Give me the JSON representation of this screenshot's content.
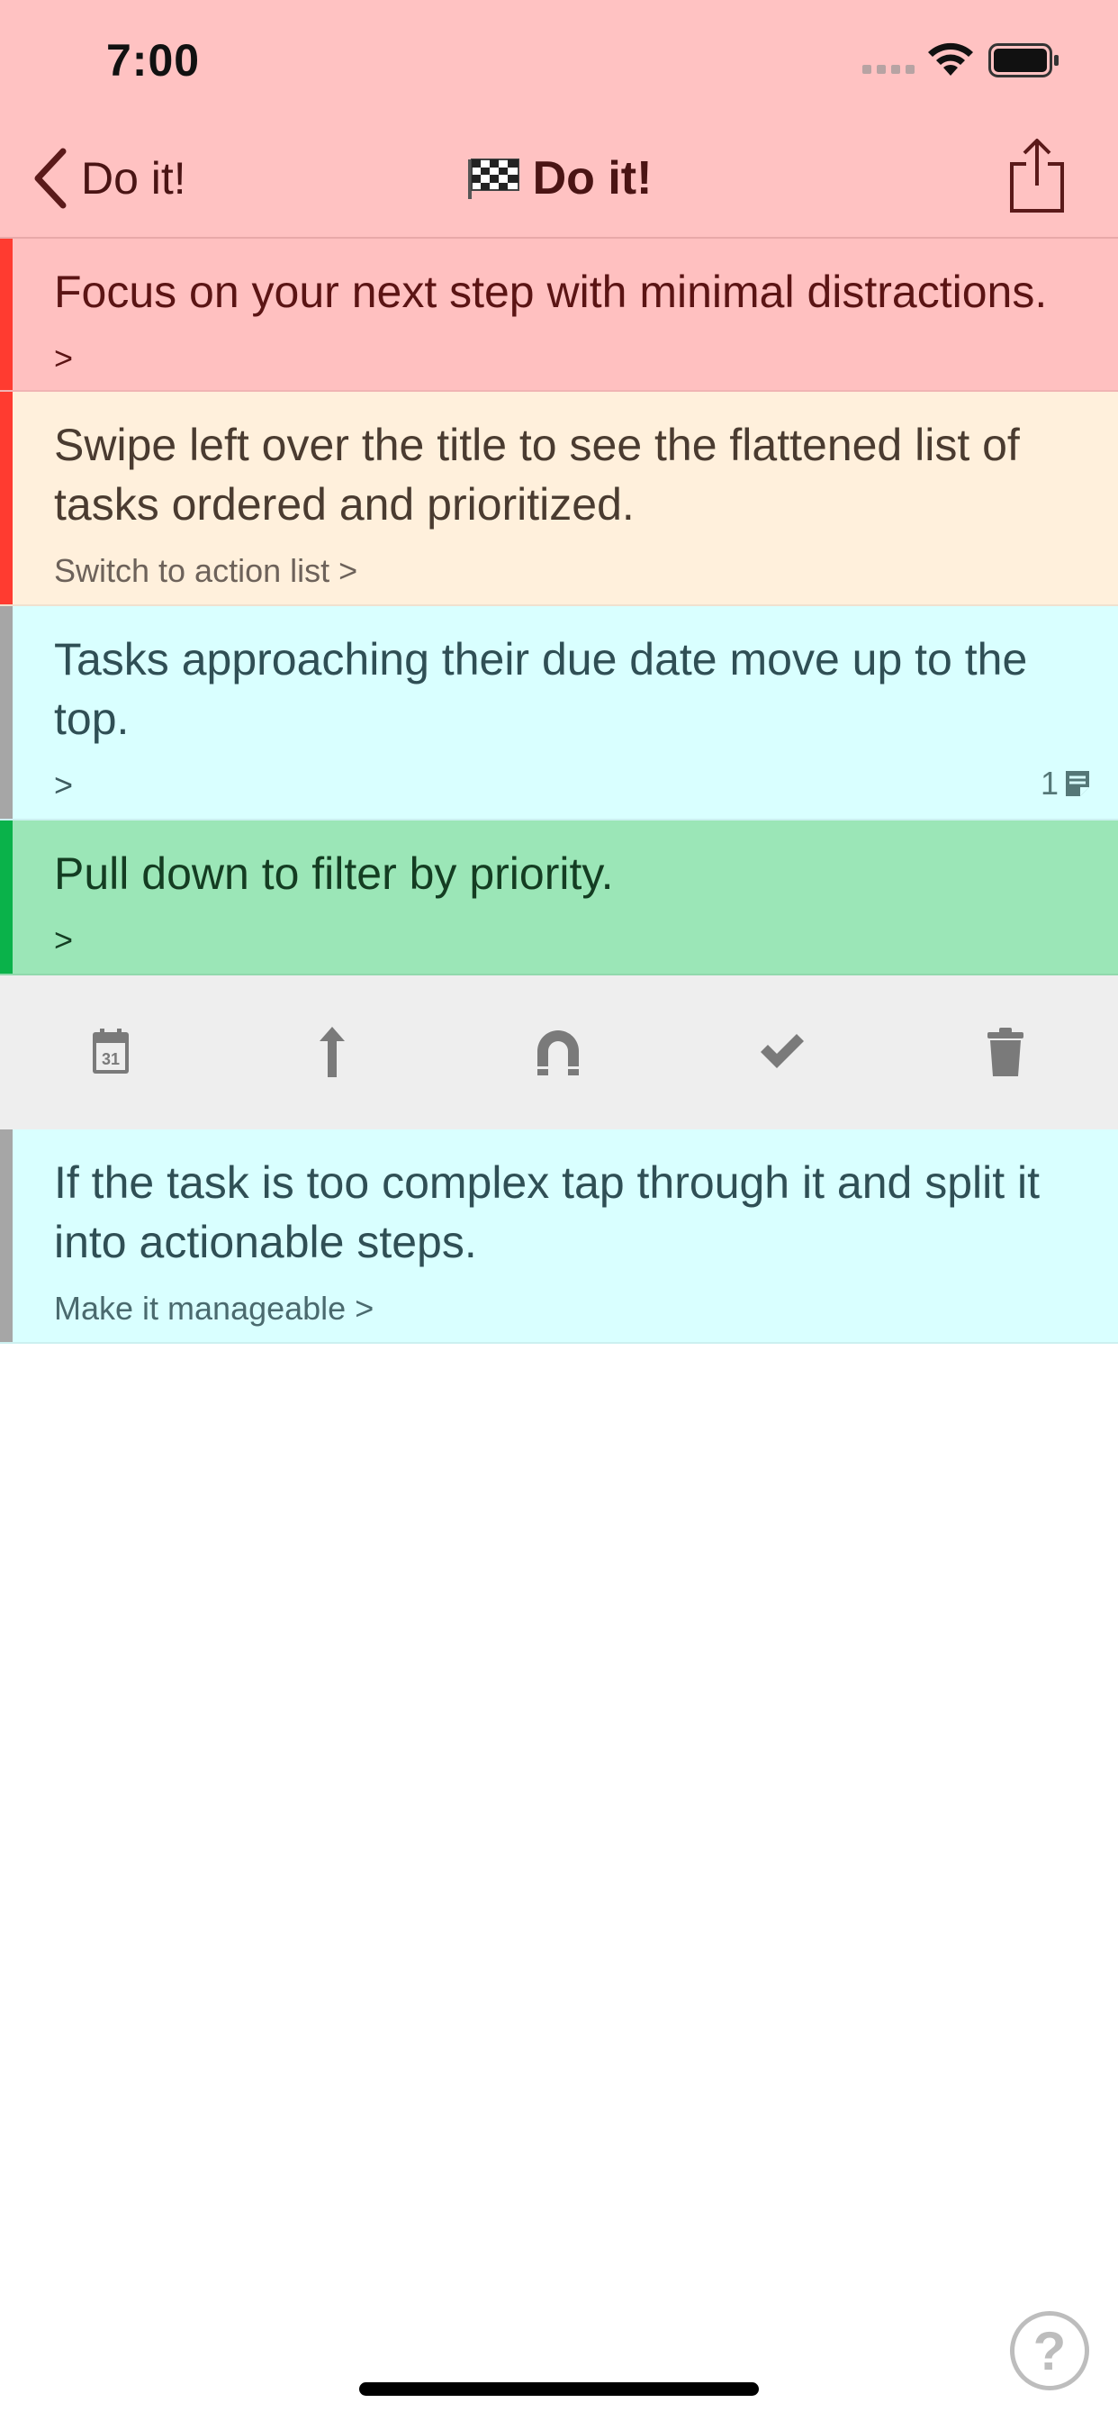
{
  "status": {
    "time": "7:00"
  },
  "nav": {
    "back_label": "Do it!",
    "title": "Do it!"
  },
  "rows": [
    {
      "title": "Focus on your next step with minimal distractions.",
      "sub": ">",
      "priority_color": "#ff3b30"
    },
    {
      "title": "Swipe left over the title to see the flattened list of tasks ordered and prioritized.",
      "sub": "Switch to action list >",
      "priority_color": "#ff3b30"
    },
    {
      "title": "Tasks approaching their due date move up to the top.",
      "sub": ">",
      "count": "1",
      "priority_color": "#a6a6a6"
    },
    {
      "title": "Pull down to filter by priority.",
      "sub": ">",
      "priority_color": "#0ab24a"
    },
    {
      "title": "If the task is too complex tap through it and split it into actionable steps.",
      "sub": "Make it manageable >",
      "priority_color": "#a6a6a6"
    }
  ],
  "toolbar": {
    "actions": [
      "calendar-icon",
      "move-top-icon",
      "magnet-icon",
      "checkmark-icon",
      "trash-icon"
    ],
    "calendar_day": "31"
  },
  "help": {
    "label": "?"
  },
  "colors": {
    "header_bg": "#ffc2c2",
    "toolbar_bg": "#eeeeee"
  }
}
